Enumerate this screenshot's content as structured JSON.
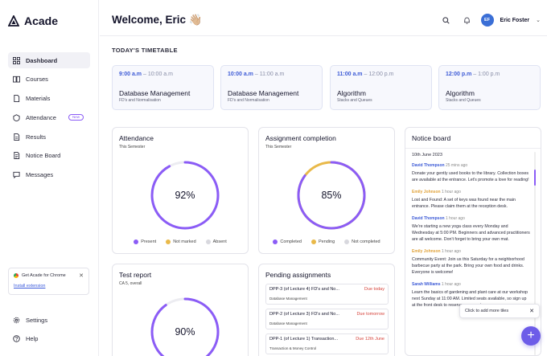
{
  "app": {
    "name": "Acade"
  },
  "sidebar": {
    "items": [
      {
        "label": "Dashboard",
        "icon": "dashboard-icon",
        "active": true
      },
      {
        "label": "Courses",
        "icon": "book-icon"
      },
      {
        "label": "Materials",
        "icon": "document-icon"
      },
      {
        "label": "Attendance",
        "icon": "attendance-icon",
        "badge": "New"
      },
      {
        "label": "Results",
        "icon": "results-icon"
      },
      {
        "label": "Notice Board",
        "icon": "notice-icon"
      },
      {
        "label": "Messages",
        "icon": "message-icon"
      }
    ],
    "promo": {
      "text": "Get Acade for Chrome",
      "link": "Install extension"
    },
    "bottom": [
      {
        "label": "Settings",
        "icon": "gear-icon"
      },
      {
        "label": "Help",
        "icon": "help-icon"
      }
    ]
  },
  "header": {
    "welcome": "Welcome, Eric 👋🏼",
    "user": {
      "initials": "EF",
      "name": "Eric Foster"
    }
  },
  "timetable": {
    "title": "TODAY'S TIMETABLE",
    "slots": [
      {
        "start": "9:00 a.m",
        "end": "– 10:00 a.m",
        "subject": "Database Management",
        "topic": "FD's and Normalisation"
      },
      {
        "start": "10:00 a.m",
        "end": "– 11:00 a.m",
        "subject": "Database Management",
        "topic": "FD's and Normalisation"
      },
      {
        "start": "11:00 a.m",
        "end": "– 12:00 p.m",
        "subject": "Algorithm",
        "topic": "Stacks and Queues"
      },
      {
        "start": "12:00 p.m",
        "end": "– 1:00 p.m",
        "subject": "Algorithm",
        "topic": "Stacks and Queues"
      }
    ]
  },
  "attendance": {
    "title": "Attendance",
    "subtitle": "This Semester",
    "value": "92%",
    "fraction": 0.92,
    "legend": [
      "Present",
      "Not marked",
      "Absent"
    ]
  },
  "assignment": {
    "title": "Assignment completion",
    "subtitle": "This Semester",
    "value": "85%",
    "fraction": 0.85,
    "legend": [
      "Completed",
      "Pending",
      "Not completed"
    ]
  },
  "test_report": {
    "title": "Test report",
    "subtitle": "CA 5, overall",
    "value": "90%",
    "fraction": 0.9
  },
  "pending": {
    "title": "Pending assignments",
    "items": [
      {
        "title": "DPP-3 (of Lecture 4) FD's and No...",
        "due": "Due today",
        "course": "Database Management"
      },
      {
        "title": "DPP-2 (of Lecture 3) FD's and No...",
        "due": "Due tomorrow",
        "course": "Database Management"
      },
      {
        "title": "DPP-1 (of Lecture 1) Transaction...",
        "due": "Due 12th June",
        "course": "Transaction & Money Control"
      }
    ]
  },
  "notice": {
    "title": "Notice board",
    "date": "10th June 2023",
    "notes": [
      {
        "author": "David Thompson",
        "time": "25 mins ago",
        "color": "#3c5ad6",
        "text": "Donate your gently used books to the library. Collection boxes are available at the entrance. Let's promote a love for reading!"
      },
      {
        "author": "Emily Johnson",
        "time": "1 hour ago",
        "color": "#e0a23a",
        "text": "Lost and Found: A set of keys was found near the main entrance. Please claim them at the reception desk."
      },
      {
        "author": "David Thompson",
        "time": "1 hour ago",
        "color": "#3c5ad6",
        "text": "We're starting a new yoga class every Monday and Wednesday at 5:00 PM. Beginners and advanced practitioners are all welcome. Don't forget to bring your own mat."
      },
      {
        "author": "Emily Johnson",
        "time": "1 hour ago",
        "color": "#e0a23a",
        "text": "Community Event: Join us this Saturday for a neighborhood barbecue party at the park. Bring your own food and drinks. Everyone is welcome!"
      },
      {
        "author": "Sarah Williams",
        "time": "1 hour ago",
        "color": "#3c5ad6",
        "text": "Learn the basics of gardening and plant care at our workshop next Sunday at 11:00 AM. Limited seats available, so sign up at the front desk to reserve your spot."
      }
    ]
  },
  "tooltip": {
    "text": "Click to add more tiles"
  },
  "colors": {
    "accent": "#8b5cf6",
    "pending": "#e9b949",
    "absent": "#d8d8de",
    "blue": "#3c5ad6"
  }
}
